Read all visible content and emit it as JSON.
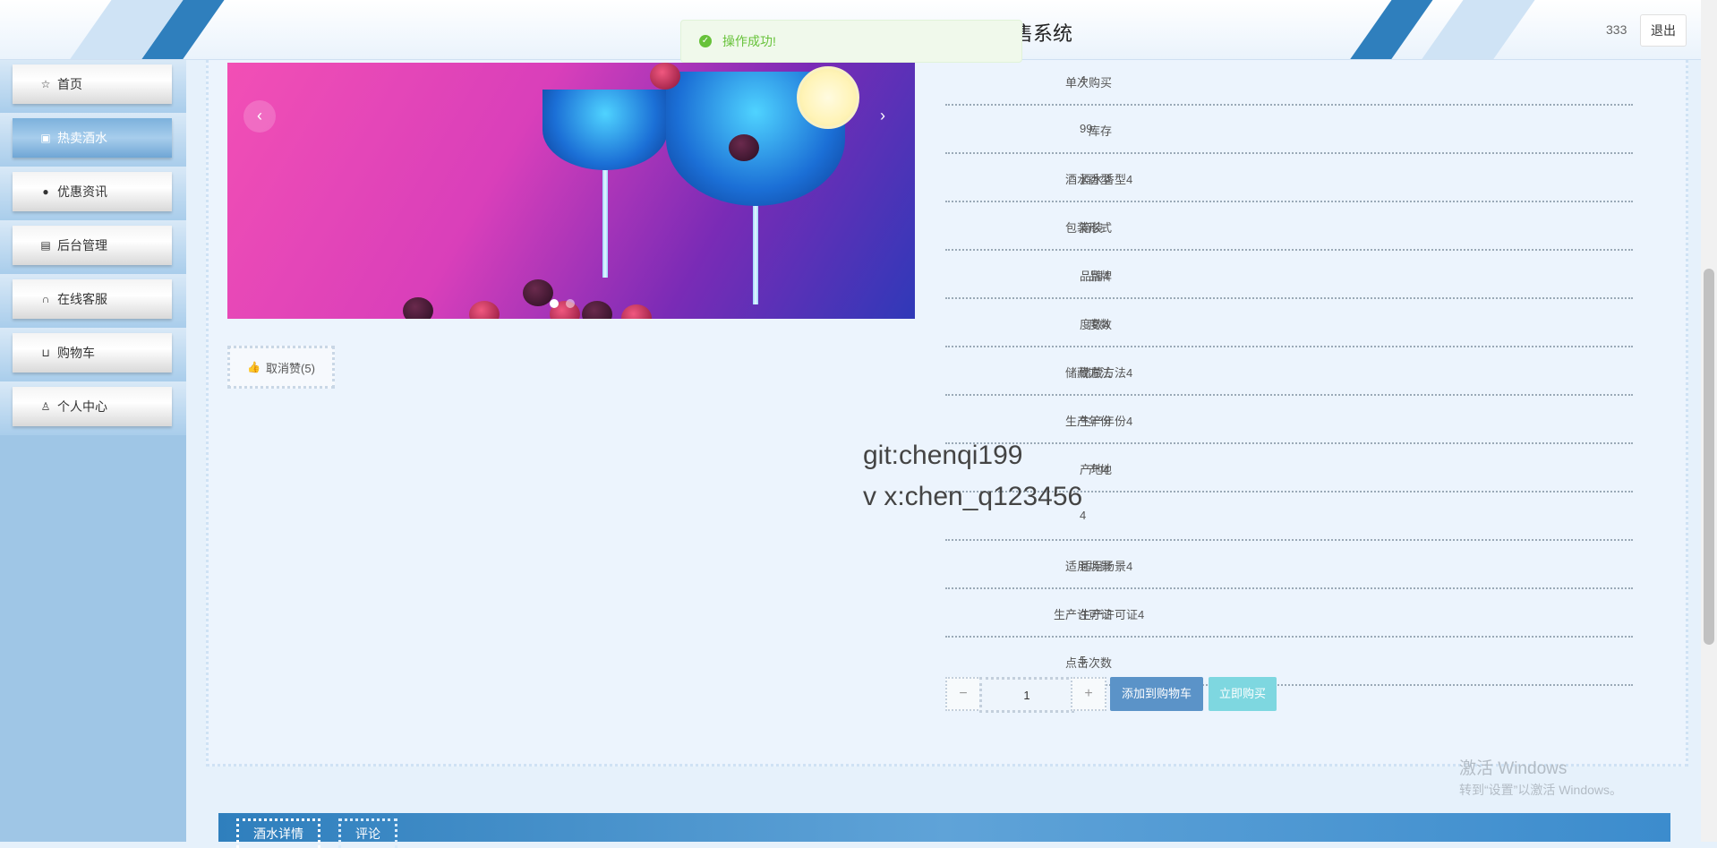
{
  "header": {
    "title": "售系统",
    "user": "333",
    "logout_label": "退出"
  },
  "toast": {
    "text": "操作成功!"
  },
  "sidebar": {
    "items": [
      {
        "label": "首页",
        "icon": "star-icon",
        "active": false
      },
      {
        "label": "热卖酒水",
        "icon": "shopping-bag-icon",
        "active": true
      },
      {
        "label": "优惠资讯",
        "icon": "info-circle-icon",
        "active": false
      },
      {
        "label": "后台管理",
        "icon": "briefcase-icon",
        "active": false
      },
      {
        "label": "在线客服",
        "icon": "headset-icon",
        "active": false
      },
      {
        "label": "购物车",
        "icon": "cart-icon",
        "active": false
      },
      {
        "label": "个人中心",
        "icon": "user-icon",
        "active": false
      }
    ]
  },
  "product": {
    "like_label": "取消赞(5)",
    "quantity": "1",
    "add_cart_label": "添加到购物车",
    "buy_now_label": "立即购买",
    "details": [
      {
        "label": "单次购买",
        "value": "4"
      },
      {
        "label": "库存",
        "value": "99"
      },
      {
        "label": "酒水香型",
        "value": "酒水香型4"
      },
      {
        "label": "包装形式",
        "value": "箱装"
      },
      {
        "label": "品牌",
        "value": "品牌4"
      },
      {
        "label": "度数",
        "value": "度数4"
      },
      {
        "label": "储藏方法",
        "value": "储藏方法4"
      },
      {
        "label": "生产年份",
        "value": "生产年份4"
      },
      {
        "label": "产地",
        "value": "产地4"
      },
      {
        "label": "",
        "value": "4"
      },
      {
        "label": "适用场景",
        "value": "适用场景4"
      },
      {
        "label": "生产许可证",
        "value": "生产许可证4"
      },
      {
        "label": "点击次数",
        "value": "5"
      }
    ]
  },
  "watermark": {
    "line1": "git:chenqi199",
    "line2": "v x:chen_q123456"
  },
  "os_notice": {
    "title": "激活 Windows",
    "subtitle": "转到“设置”以激活 Windows。"
  },
  "tabs": [
    {
      "label": "酒水详情",
      "active": true
    },
    {
      "label": "评论",
      "active": false
    }
  ],
  "colors": {
    "accent": "#2f7fbd",
    "success": "#67c23a",
    "sidebar_bg": "#9fc6e6"
  }
}
